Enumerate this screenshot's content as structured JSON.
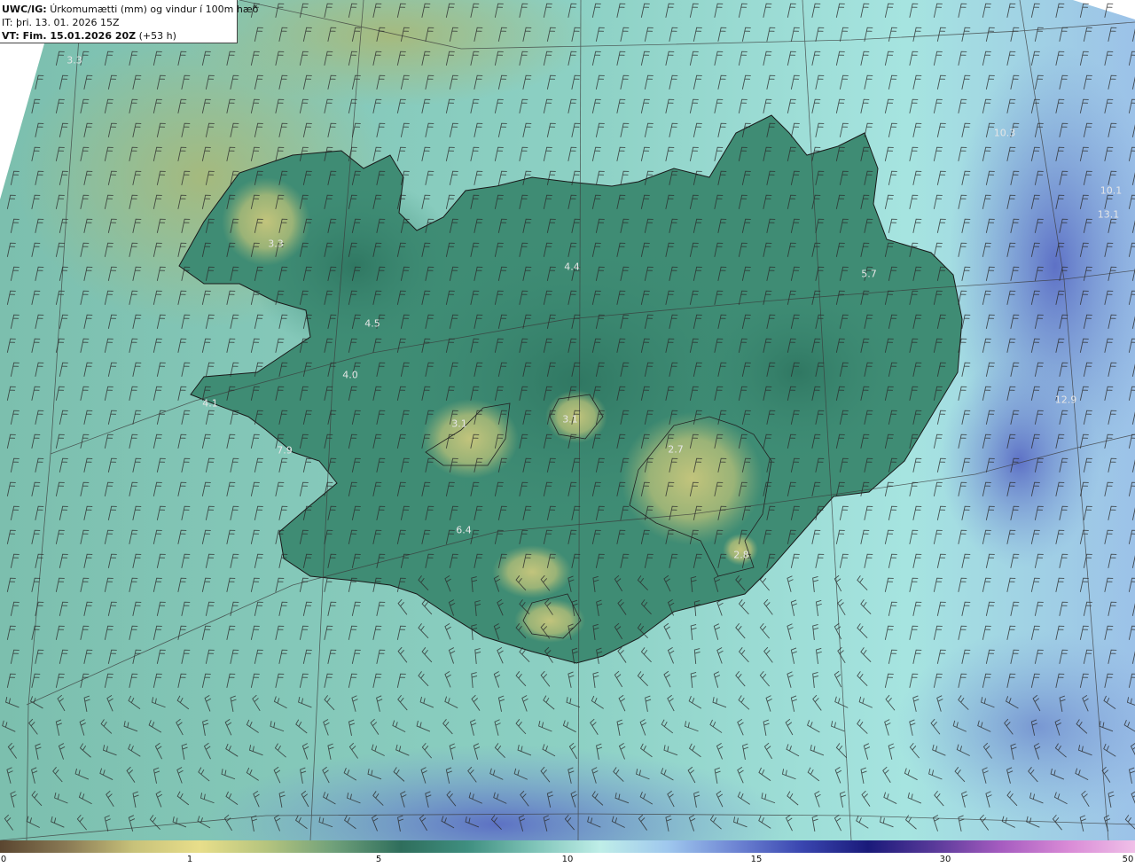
{
  "header": {
    "model_prefix": "UWC/IG:",
    "title": "Úrkomumætti (mm) og vindur í 100m hæð",
    "init_time": "IT: þri. 13. 01. 2026 15Z",
    "valid_prefix": "VT: Fim. 15.01.2026 20Z",
    "valid_suffix": "(+53 h)"
  },
  "colorbar": {
    "ticks": [
      "0",
      "1",
      "5",
      "10",
      "15",
      "30",
      "50"
    ],
    "colors": [
      "#5a4630",
      "#8a7a55",
      "#c8c27a",
      "#e8de8a",
      "#b5c47e",
      "#6fa07a",
      "#2f6e5c",
      "#3f8f80",
      "#7fc4b8",
      "#bfeee8",
      "#9fc8ee",
      "#6f86d4",
      "#3a46b0",
      "#1a1a7a",
      "#5a3a9a",
      "#a65cc0",
      "#d98ad6",
      "#f0c0e8"
    ]
  },
  "map": {
    "region": "Iceland",
    "background_color": "#8fd2c8",
    "land_low_color": "#3c8a72",
    "land_dry_color": "#b9c079",
    "sea_wet_color": "#6878c8",
    "values": [
      {
        "text": "3.3"
      },
      {
        "text": "3.3"
      },
      {
        "text": "4.4"
      },
      {
        "text": "5.7"
      },
      {
        "text": "10.3"
      },
      {
        "text": "10.1"
      },
      {
        "text": "13.1"
      },
      {
        "text": "4.5"
      },
      {
        "text": "4.0"
      },
      {
        "text": "4.1"
      },
      {
        "text": "3.1"
      },
      {
        "text": "3.1"
      },
      {
        "text": "7.9"
      },
      {
        "text": "2.7"
      },
      {
        "text": "12.9"
      },
      {
        "text": "6.4"
      },
      {
        "text": "2.8"
      }
    ]
  }
}
